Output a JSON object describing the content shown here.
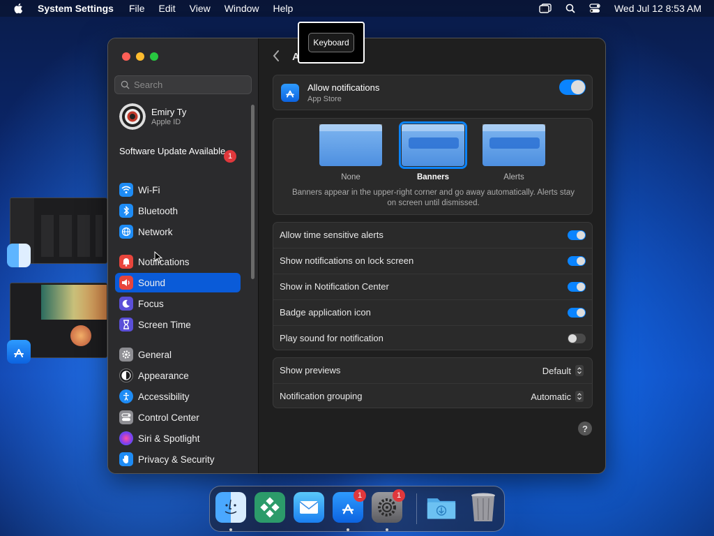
{
  "menubar": {
    "app_name": "System Settings",
    "menus": [
      "File",
      "Edit",
      "View",
      "Window",
      "Help"
    ],
    "datetime": "Wed Jul 12  8:53 AM",
    "icons": [
      "apple-icon",
      "window-icon",
      "search-icon",
      "control-center-icon"
    ]
  },
  "tooltip": {
    "text": "Keyboard"
  },
  "sidebar": {
    "search_placeholder": "Search",
    "profile": {
      "name": "Emiry Ty",
      "subtitle": "Apple ID"
    },
    "update": {
      "label": "Software Update Available",
      "badge": "1"
    },
    "items": [
      {
        "label": "Wi-Fi",
        "icon": "wifi-icon",
        "color": "#1e8cf5"
      },
      {
        "label": "Bluetooth",
        "icon": "bluetooth-icon",
        "color": "#1e8cf5"
      },
      {
        "label": "Network",
        "icon": "globe-icon",
        "color": "#1e8cf5"
      },
      {
        "label": "Notifications",
        "icon": "bell-icon",
        "color": "#e8453c"
      },
      {
        "label": "Sound",
        "icon": "speaker-icon",
        "color": "#e8453c",
        "selected": true
      },
      {
        "label": "Focus",
        "icon": "moon-icon",
        "color": "#5b4fd8"
      },
      {
        "label": "Screen Time",
        "icon": "hourglass-icon",
        "color": "#5b4fd8"
      },
      {
        "label": "General",
        "icon": "gear-icon",
        "color": "#8e8e93"
      },
      {
        "label": "Appearance",
        "icon": "appearance-icon",
        "color": "#1c1c1e"
      },
      {
        "label": "Accessibility",
        "icon": "accessibility-icon",
        "color": "#1e8cf5"
      },
      {
        "label": "Control Center",
        "icon": "control-center-icon",
        "color": "#8e8e93"
      },
      {
        "label": "Siri & Spotlight",
        "icon": "siri-icon",
        "color": "#b04ad8"
      },
      {
        "label": "Privacy & Security",
        "icon": "hand-icon",
        "color": "#1e8cf5"
      }
    ]
  },
  "content": {
    "back_label": "A",
    "allow": {
      "title": "Allow notifications",
      "subtitle": "App Store",
      "on": true
    },
    "styles": {
      "options": [
        {
          "label": "None",
          "selected": false
        },
        {
          "label": "Banners",
          "selected": true
        },
        {
          "label": "Alerts",
          "selected": false
        }
      ],
      "description": "Banners appear in the upper-right corner and go away automatically. Alerts stay on screen until dismissed."
    },
    "toggles": [
      {
        "label": "Allow time sensitive alerts",
        "on": true
      },
      {
        "label": "Show notifications on lock screen",
        "on": true
      },
      {
        "label": "Show in Notification Center",
        "on": true
      },
      {
        "label": "Badge application icon",
        "on": true
      },
      {
        "label": "Play sound for notification",
        "on": false
      }
    ],
    "selects": [
      {
        "label": "Show previews",
        "value": "Default"
      },
      {
        "label": "Notification grouping",
        "value": "Automatic"
      }
    ],
    "help": "?"
  },
  "dock": {
    "items": [
      {
        "name": "finder",
        "running": true,
        "badge": ""
      },
      {
        "name": "app-2",
        "running": false,
        "badge": ""
      },
      {
        "name": "mail",
        "running": false,
        "badge": ""
      },
      {
        "name": "app-store",
        "running": true,
        "badge": "1"
      },
      {
        "name": "system-settings",
        "running": true,
        "badge": "1"
      },
      {
        "name": "downloads",
        "running": false,
        "badge": ""
      },
      {
        "name": "trash",
        "running": false,
        "badge": ""
      }
    ]
  }
}
